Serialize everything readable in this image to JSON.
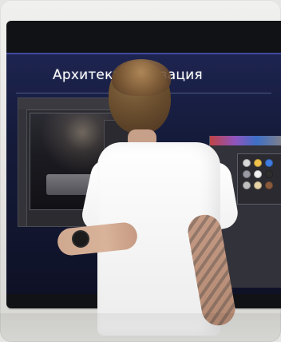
{
  "screen": {
    "title": "Архитекту    ализация"
  },
  "palette": {
    "accent": "#3f4aa0",
    "screen_top": "#1d2450",
    "screen_bottom": "#0f1226",
    "shirt": "#f4f4f4"
  }
}
